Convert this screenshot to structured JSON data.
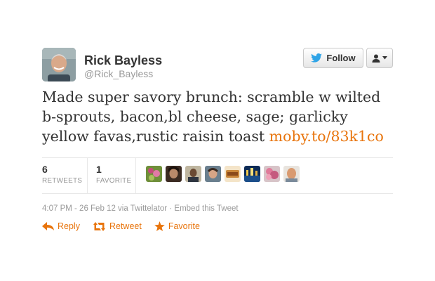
{
  "author": {
    "name": "Rick Bayless",
    "handle": "@Rick_Bayless"
  },
  "follow_button": {
    "label": "Follow",
    "icon": "twitter-bird-icon"
  },
  "user_menu": {
    "icon": "user-menu-icon"
  },
  "tweet": {
    "text": "Made super savory brunch: scramble w wilted b-sprouts, bacon,bl cheese, sage; garlicky yellow favas,rustic raisin toast",
    "link": "moby.to/83k1co"
  },
  "stats": {
    "retweets_count": "6",
    "retweets_label": "RETWEETS",
    "favorites_count": "1",
    "favorites_label": "FAVORITE"
  },
  "meta": {
    "timestamp": "4:07 PM - 26 Feb 12",
    "via": "via Twittelator",
    "separator": "·",
    "embed": "Embed this Tweet"
  },
  "actions": {
    "reply": "Reply",
    "retweet": "Retweet",
    "favorite": "Favorite"
  },
  "colors": {
    "link": "#e8740c",
    "twitter_blue": "#2fa4e7"
  }
}
